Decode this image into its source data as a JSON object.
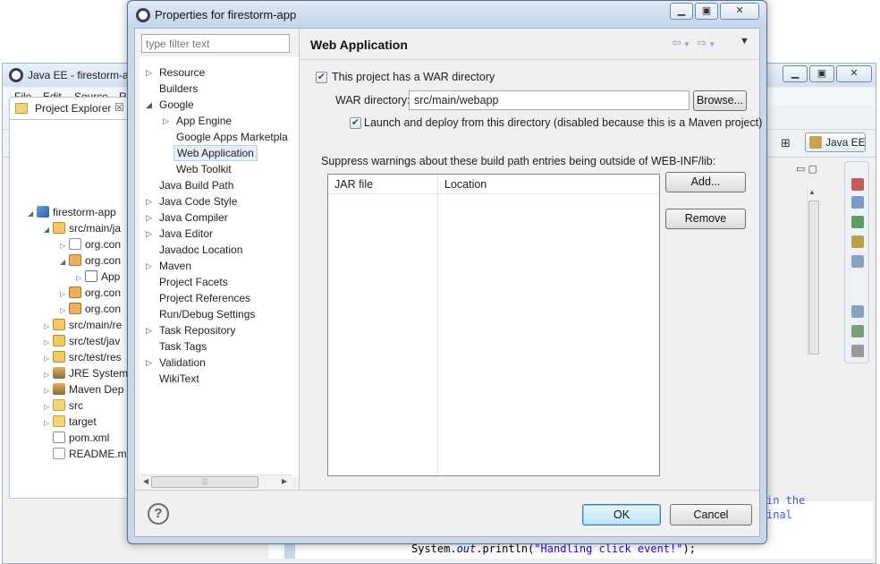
{
  "background_window": {
    "title": "Java EE - firestorm-ap",
    "menus": [
      "File",
      "Edit",
      "Source",
      "Re"
    ],
    "perspective_label": "Java EE",
    "project_explorer": {
      "tab_label": "Project Explorer",
      "tab_close": "☒",
      "items": [
        {
          "label": "firestorm-app",
          "icon": "project-icon",
          "expand": "◢"
        },
        {
          "label": "src/main/ja",
          "icon": "source-folder-icon",
          "expand": "◢"
        },
        {
          "label": "org.con",
          "icon": "empty-package-icon",
          "expand": "▷"
        },
        {
          "label": "org.con",
          "icon": "package-icon",
          "expand": "◢"
        },
        {
          "label": "App",
          "icon": "java-file-icon",
          "expand": "▷"
        },
        {
          "label": "org.con",
          "icon": "package-icon",
          "expand": "▷"
        },
        {
          "label": "org.con",
          "icon": "package-icon",
          "expand": "▷"
        },
        {
          "label": "src/main/re",
          "icon": "source-folder-icon",
          "expand": "▷"
        },
        {
          "label": "src/test/jav",
          "icon": "source-folder-icon",
          "expand": "▷"
        },
        {
          "label": "src/test/res",
          "icon": "source-folder-icon",
          "expand": "▷"
        },
        {
          "label": "JRE System",
          "icon": "library-icon",
          "expand": "▷"
        },
        {
          "label": "Maven Dep",
          "icon": "library-icon",
          "expand": "▷"
        },
        {
          "label": "src",
          "icon": "folder-icon",
          "expand": "▷"
        },
        {
          "label": "target",
          "icon": "folder-icon",
          "expand": "▷"
        },
        {
          "label": "pom.xml",
          "icon": "xml-file-icon",
          "expand": ""
        },
        {
          "label": "README.m",
          "icon": "text-file-icon",
          "expand": ""
        }
      ]
    },
    "editor": {
      "frag1": "in the",
      "frag2": "inal",
      "code_prefix": "System.",
      "code_out": "out",
      "code_mid": ".println(",
      "code_string": "\"Handling click event!\"",
      "code_suffix": ");"
    }
  },
  "dialog": {
    "title": "Properties for firestorm-app",
    "filter_placeholder": "type filter text",
    "nav_items": [
      {
        "label": "Resource",
        "expand": "▷"
      },
      {
        "label": "Builders",
        "expand": ""
      },
      {
        "label": "Google",
        "expand": "◢"
      },
      {
        "label": "App Engine",
        "expand": "▷"
      },
      {
        "label": "Google Apps Marketpla",
        "expand": ""
      },
      {
        "label": "Web Application",
        "expand": "",
        "selected": true
      },
      {
        "label": "Web Toolkit",
        "expand": ""
      },
      {
        "label": "Java Build Path",
        "expand": ""
      },
      {
        "label": "Java Code Style",
        "expand": "▷"
      },
      {
        "label": "Java Compiler",
        "expand": "▷"
      },
      {
        "label": "Java Editor",
        "expand": "▷"
      },
      {
        "label": "Javadoc Location",
        "expand": ""
      },
      {
        "label": "Maven",
        "expand": "▷"
      },
      {
        "label": "Project Facets",
        "expand": ""
      },
      {
        "label": "Project References",
        "expand": ""
      },
      {
        "label": "Run/Debug Settings",
        "expand": ""
      },
      {
        "label": "Task Repository",
        "expand": "▷"
      },
      {
        "label": "Task Tags",
        "expand": ""
      },
      {
        "label": "Validation",
        "expand": "▷"
      },
      {
        "label": "WikiText",
        "expand": ""
      }
    ],
    "page": {
      "title": "Web Application",
      "has_war_label": "This project has a WAR directory",
      "has_war_checked": true,
      "war_dir_label": "WAR directory:",
      "war_dir_value": "src/main/webapp",
      "browse_label": "Browse...",
      "launch_label": "Launch and deploy from this directory (disabled because this is a Maven project)",
      "launch_checked": true,
      "suppress_label": "Suppress warnings about these build path entries being outside of WEB-INF/lib:",
      "table": {
        "columns": [
          "JAR file",
          "Location"
        ],
        "rows": []
      },
      "add_label": "Add...",
      "remove_label": "Remove"
    },
    "ok_label": "OK",
    "cancel_label": "Cancel",
    "help_glyph": "?"
  }
}
